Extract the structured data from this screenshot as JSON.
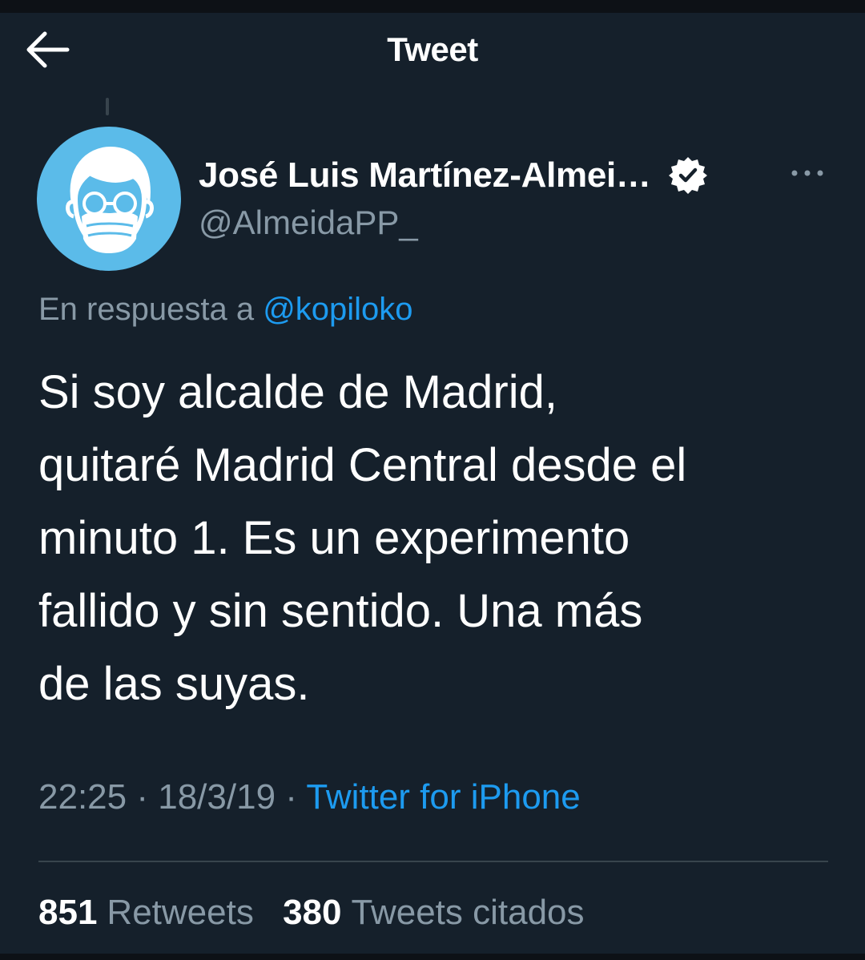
{
  "header": {
    "title": "Tweet",
    "back_icon": "arrow-left-icon"
  },
  "author": {
    "display_name": "José Luis Martínez-Almei…",
    "handle": "@AlmeidaPP_",
    "avatar_icon": "masked-face-avatar",
    "verified_icon": "verified-badge-icon",
    "more_icon": "more-dots-icon"
  },
  "reply": {
    "prefix": "En respuesta a",
    "mention": "@kopiloko"
  },
  "tweet": {
    "text": "Si soy alcalde de Madrid,\nquitaré Madrid Central desde el\nminuto 1. Es un experimento\nfallido y sin sentido. Una más\nde las suyas."
  },
  "meta": {
    "time": "22:25",
    "separator": "·",
    "date": "18/3/19",
    "source": "Twitter for iPhone"
  },
  "stats": {
    "retweets_count": "851",
    "retweets_label": "Retweets",
    "quotes_count": "380",
    "quotes_label": "Tweets citados"
  },
  "colors": {
    "background": "#15202b",
    "text_primary": "#ffffff",
    "text_secondary": "#8899a6",
    "link": "#1d9bf0",
    "avatar_bg": "#5bbbe9",
    "divider": "#38444d"
  }
}
